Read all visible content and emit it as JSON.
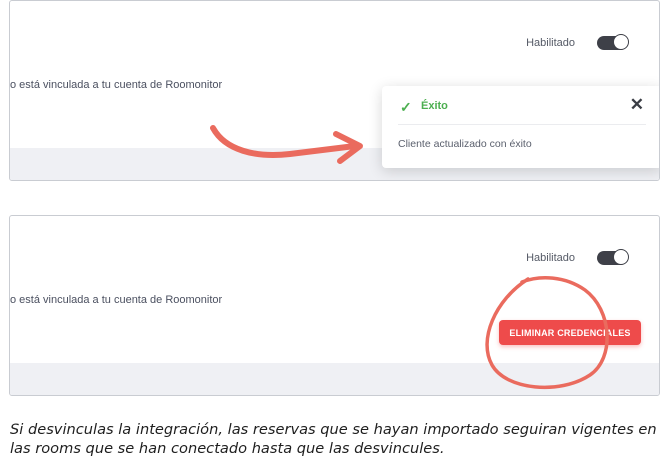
{
  "top_panel": {
    "toggle_label": "Habilitado",
    "toggle_state": "on",
    "link_text": "o está vinculada a tu cuenta de Roomonitor",
    "toast": {
      "title": "Éxito",
      "message": "Cliente actualizado con éxito",
      "check_icon": "check-icon",
      "close_icon": "close-icon"
    }
  },
  "bottom_panel": {
    "toggle_label": "Habilitado",
    "toggle_state": "on",
    "link_text": "o está vinculada a tu cuenta de Roomonitor",
    "delete_button_label": "ELIMINAR CREDENCIALES"
  },
  "caption": "Si desvinculas la integración, las reservas que se hayan importado seguiran vigentes en las rooms que se han conectado hasta que las desvincules.",
  "colors": {
    "accent_red": "#ee4b4b",
    "annotation_coral": "#ea6b5e",
    "success_green": "#4caf50",
    "toggle_dark": "#3e4048"
  }
}
